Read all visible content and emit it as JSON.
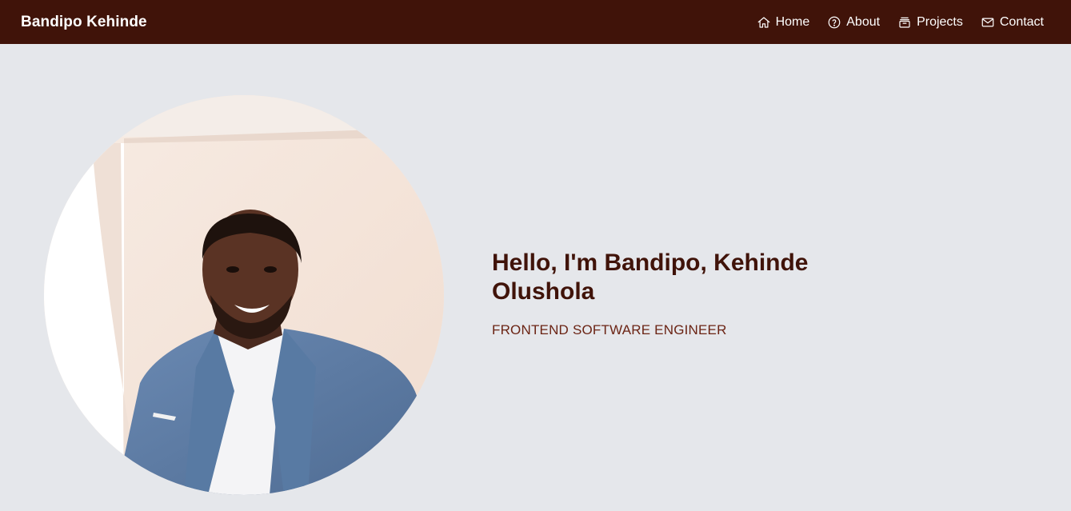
{
  "navbar": {
    "brand": "Bandipo Kehinde",
    "links": [
      {
        "label": "Home",
        "icon": "home-icon"
      },
      {
        "label": "About",
        "icon": "question-circle-icon"
      },
      {
        "label": "Projects",
        "icon": "archive-box-icon"
      },
      {
        "label": "Contact",
        "icon": "envelope-icon"
      }
    ]
  },
  "hero": {
    "heading": "Hello, I'm Bandipo, Kehinde Olushola",
    "subtitle": "FRONTEND SOFTWARE ENGINEER",
    "photo": "portrait-photo"
  },
  "colors": {
    "navbar_bg": "#401309",
    "page_bg": "#e5e7eb",
    "heading": "#401309",
    "subtitle": "#6b2414"
  }
}
